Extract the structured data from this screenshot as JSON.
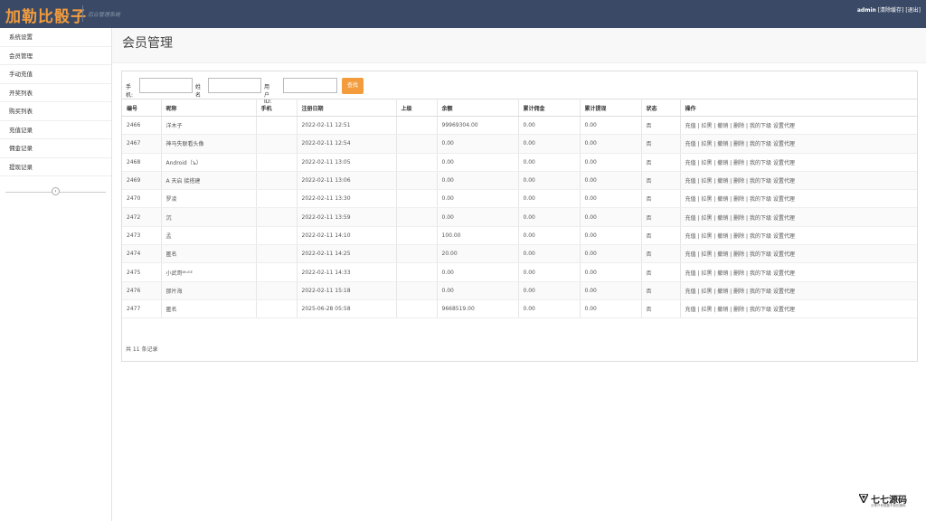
{
  "header": {
    "logo": "加勒比骰子",
    "subtitle": "后台管理系统",
    "user": "admin",
    "clear_cache": "[清除缓存]",
    "logout": "[退出]"
  },
  "sidebar": {
    "items": [
      {
        "label": "系统设置"
      },
      {
        "label": "会员管理"
      },
      {
        "label": "手动充值"
      },
      {
        "label": "开奖列表"
      },
      {
        "label": "购买列表"
      },
      {
        "label": "充值记录"
      },
      {
        "label": "佣金记录"
      },
      {
        "label": "提现记录"
      }
    ],
    "collapse_icon": "chevron-left-icon"
  },
  "page": {
    "title": "会员管理"
  },
  "search": {
    "phone_label": "手机:",
    "name_label": "姓名",
    "uid_label": "用户ID:",
    "button": "查找"
  },
  "table": {
    "headers": [
      "编号",
      "昵称",
      "手机",
      "注册日期",
      "上级",
      "余额",
      "累计佣金",
      "累计提现",
      "状态",
      "操作"
    ],
    "rows": [
      {
        "id": "2466",
        "nick": "洋木子",
        "phone": "",
        "date": "2022-02-11 12:51",
        "parent": "",
        "balance": "99969304.00",
        "commission": "0.00",
        "withdraw": "0.00",
        "status": "否"
      },
      {
        "id": "2467",
        "nick": "神马失联看头像",
        "phone": "",
        "date": "2022-02-11 12:54",
        "parent": "",
        "balance": "0.00",
        "commission": "0.00",
        "withdraw": "0.00",
        "status": "否"
      },
      {
        "id": "2468",
        "nick": "Android（ъ）",
        "phone": "",
        "date": "2022-02-11 13:05",
        "parent": "",
        "balance": "0.00",
        "commission": "0.00",
        "withdraw": "0.00",
        "status": "否"
      },
      {
        "id": "2469",
        "nick": "A 天启 接搭建",
        "phone": "",
        "date": "2022-02-11 13:06",
        "parent": "",
        "balance": "0.00",
        "commission": "0.00",
        "withdraw": "0.00",
        "status": "否"
      },
      {
        "id": "2470",
        "nick": "罗凌",
        "phone": "",
        "date": "2022-02-11 13:30",
        "parent": "",
        "balance": "0.00",
        "commission": "0.00",
        "withdraw": "0.00",
        "status": "否"
      },
      {
        "id": "2472",
        "nick": "沉",
        "phone": "",
        "date": "2022-02-11 13:59",
        "parent": "",
        "balance": "0.00",
        "commission": "0.00",
        "withdraw": "0.00",
        "status": "否"
      },
      {
        "id": "2473",
        "nick": "孟",
        "phone": "",
        "date": "2022-02-11 14:10",
        "parent": "",
        "balance": "100.00",
        "commission": "0.00",
        "withdraw": "0.00",
        "status": "否"
      },
      {
        "id": "2474",
        "nick": "匿名",
        "phone": "",
        "date": "2022-02-11 14:25",
        "parent": "",
        "balance": "20.00",
        "commission": "0.00",
        "withdraw": "0.00",
        "status": "否"
      },
      {
        "id": "2475",
        "nick": "小武哥ᵂᵘᴳᴱ",
        "phone": "",
        "date": "2022-02-11 14:33",
        "parent": "",
        "balance": "0.00",
        "commission": "0.00",
        "withdraw": "0.00",
        "status": "否"
      },
      {
        "id": "2476",
        "nick": "那片海",
        "phone": "",
        "date": "2022-02-11 15:18",
        "parent": "",
        "balance": "0.00",
        "commission": "0.00",
        "withdraw": "0.00",
        "status": "否"
      },
      {
        "id": "2477",
        "nick": "匿名",
        "phone": "",
        "date": "2025-06-28 05:58",
        "parent": "",
        "balance": "9668519.00",
        "commission": "0.00",
        "withdraw": "0.00",
        "status": "否"
      }
    ],
    "ops": [
      "充值",
      "拉黑",
      "撤销",
      "删除",
      "我的下级",
      "设置代理"
    ],
    "footer": "共 11 条记录"
  },
  "watermark": {
    "text": "七七源码",
    "sub": "分享只有想象不到的源码",
    "icon": "triangle-logo-icon"
  }
}
